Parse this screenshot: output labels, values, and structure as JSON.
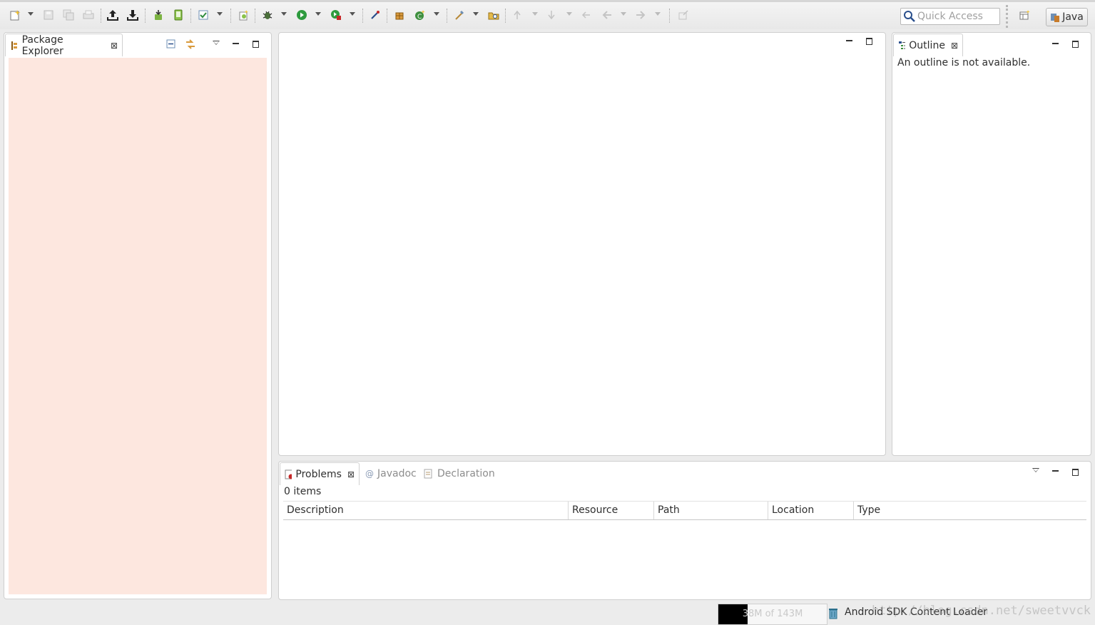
{
  "toolbar": {
    "quick_access_placeholder": "Quick Access",
    "perspective_label": "Java"
  },
  "package_explorer": {
    "tab_label": "Package Explorer",
    "background": "#fde7df"
  },
  "outline": {
    "tab_label": "Outline",
    "message": "An outline is not available."
  },
  "bottom_panel": {
    "tabs": [
      {
        "label": "Problems",
        "active": true
      },
      {
        "label": "Javadoc",
        "active": false
      },
      {
        "label": "Declaration",
        "active": false
      }
    ],
    "items_count": "0 items",
    "columns": [
      "Description",
      "Resource",
      "Path",
      "Location",
      "Type"
    ]
  },
  "status_bar": {
    "heap_label": "38M of 143M",
    "heap_used_fraction": 0.27,
    "task_label": "Android SDK Content Loader",
    "watermark": "http://blog.csdn.net/sweetvvck"
  }
}
